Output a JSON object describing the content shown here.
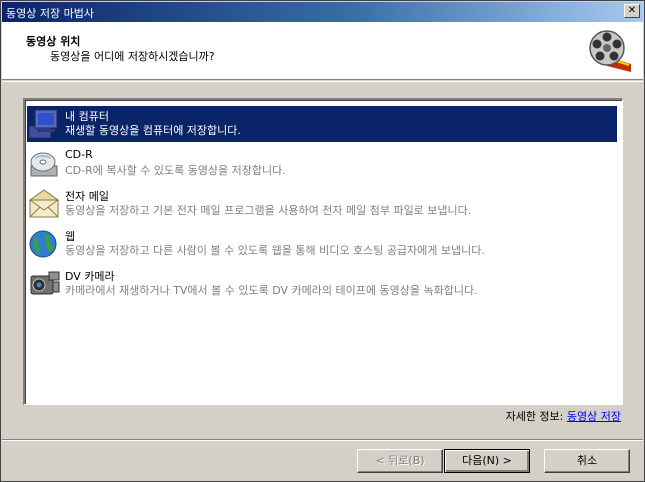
{
  "window": {
    "title": "동영상 저장 마법사",
    "close_label": "✕"
  },
  "header": {
    "title": "동영상 위치",
    "subtitle": "동영상을 어디에 저장하시겠습니까?",
    "icon": "film-reel-icon"
  },
  "options": [
    {
      "title": "내 컴퓨터",
      "desc": "재생할 동영상을 컴퓨터에 저장합니다.",
      "icon": "computer-icon",
      "selected": true
    },
    {
      "title": "CD-R",
      "desc": "CD-R에 복사할 수 있도록 동영상을 저장합니다.",
      "icon": "cd-icon",
      "selected": false
    },
    {
      "title": "전자 메일",
      "desc": "동영상을 저장하고 기본 전자 메일 프로그램을 사용하여 전자 메일 첨부 파일로 보냅니다.",
      "icon": "envelope-icon",
      "selected": false
    },
    {
      "title": "웹",
      "desc": "동영상을 저장하고 다른 사람이 볼 수 있도록 웹을 통해 비디오 호스팅 공급자에게 보냅니다.",
      "icon": "globe-icon",
      "selected": false
    },
    {
      "title": "DV 카메라",
      "desc": "카메라에서 재생하거나 TV에서 볼 수 있도록 DV 카메라의 테이프에 동영상을 녹화합니다.",
      "icon": "camcorder-icon",
      "selected": false
    }
  ],
  "more_info": {
    "label": "자세한 정보:",
    "link": "동영상 저장"
  },
  "buttons": {
    "back": "< 뒤로(B)",
    "next": "다음(N) >",
    "cancel": "취소"
  }
}
